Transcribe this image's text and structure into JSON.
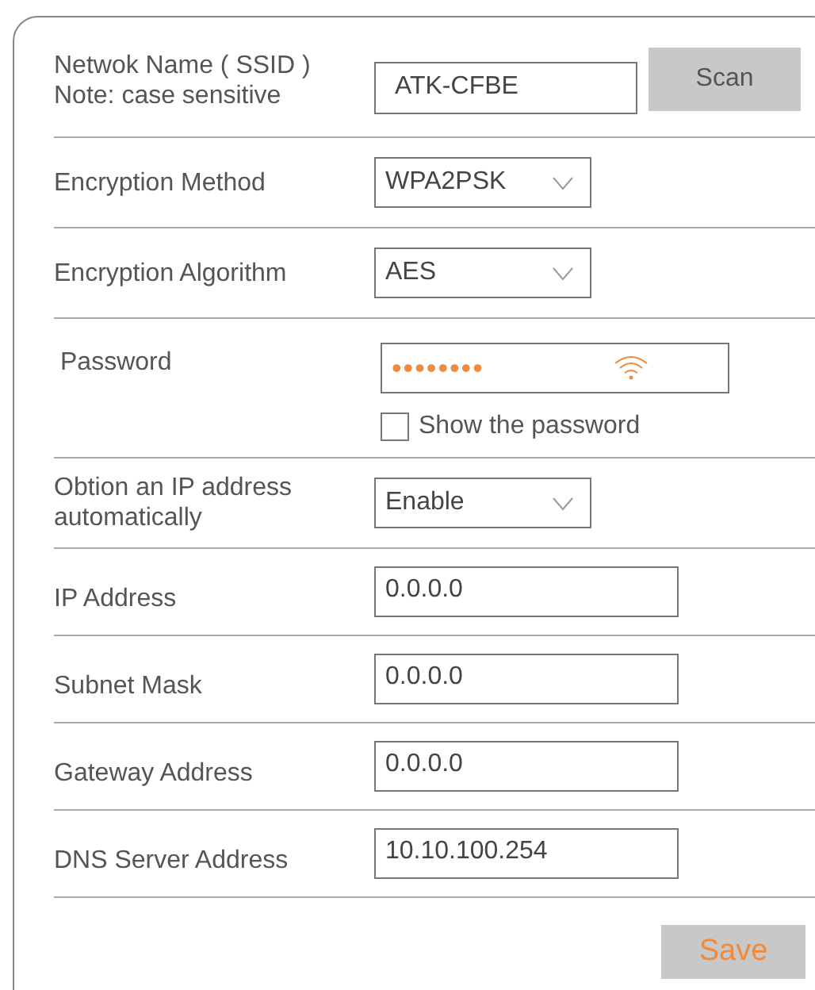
{
  "rows": [
    {
      "kind": "ssid",
      "label": "Netwok Name ( SSID )",
      "note": "Note: case sensitive",
      "value": "ATK-CFBE",
      "button": "Scan"
    },
    {
      "kind": "select",
      "label": "Encryption Method",
      "value": "WPA2PSK"
    },
    {
      "kind": "select",
      "label": "Encryption Algorithm",
      "value": "AES"
    },
    {
      "kind": "password",
      "label": "Password",
      "value": "••••••••",
      "show_password": {
        "label": "Show the password",
        "checked": false
      }
    },
    {
      "kind": "select",
      "label": "Obtion an IP address automatically",
      "value": "Enable"
    },
    {
      "kind": "text",
      "label": "IP Address",
      "value": "0.0.0.0"
    },
    {
      "kind": "text",
      "label": "Subnet Mask",
      "value": "0.0.0.0"
    },
    {
      "kind": "text",
      "label": "Gateway Address",
      "value": "0.0.0.0"
    },
    {
      "kind": "text",
      "label": "DNS Server Address",
      "value": "10.10.100.254"
    }
  ],
  "save_button": "Save"
}
